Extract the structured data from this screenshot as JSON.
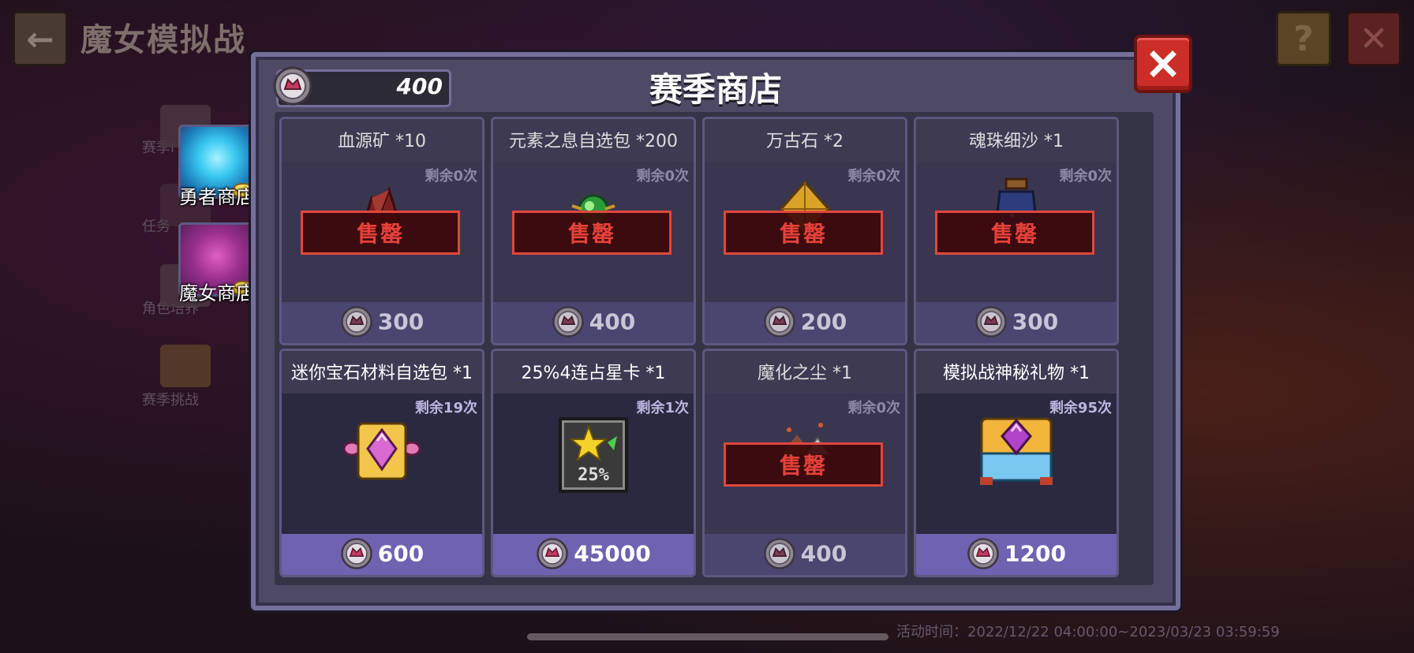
{
  "header": {
    "back_icon": "arrow-left-icon",
    "title": "魔女模拟战",
    "help_label": "?",
    "close_label": "✕"
  },
  "side_menu": {
    "items": [
      {
        "label": "赛季i"
      },
      {
        "label": "任务"
      },
      {
        "label": "角色培养"
      },
      {
        "label": "赛季挑战"
      }
    ]
  },
  "tabs": [
    {
      "label": "勇者商店"
    },
    {
      "label": "魔女商店"
    }
  ],
  "shop": {
    "title": "赛季商店",
    "currency_amount": "400",
    "currency_icon": "witch-coin-icon",
    "close_icon": "close-x-icon",
    "items": [
      {
        "name": "血源矿 *10",
        "remain": "剩余0次",
        "price": "300",
        "sold_out": true,
        "sold_label": "售罄"
      },
      {
        "name": "元素之息自选包 *200",
        "remain": "剩余0次",
        "price": "400",
        "sold_out": true,
        "sold_label": "售罄"
      },
      {
        "name": "万古石 *2",
        "remain": "剩余0次",
        "price": "200",
        "sold_out": true,
        "sold_label": "售罄"
      },
      {
        "name": "魂珠细沙 *1",
        "remain": "剩余0次",
        "price": "300",
        "sold_out": true,
        "sold_label": "售罄"
      },
      {
        "name": "迷你宝石材料自选包 *1",
        "remain": "剩余19次",
        "price": "600",
        "sold_out": false
      },
      {
        "name": "25%4连占星卡 *1",
        "remain": "剩余1次",
        "price": "45000",
        "sold_out": false,
        "card_text": "25%"
      },
      {
        "name": "魔化之尘 *1",
        "remain": "剩余0次",
        "price": "400",
        "sold_out": true,
        "sold_label": "售罄"
      },
      {
        "name": "模拟战神秘礼物 *1",
        "remain": "剩余95次",
        "price": "1200",
        "sold_out": false
      }
    ]
  },
  "footer": {
    "event_time": "活动时间：2022/12/22 04:00:00~2023/03/23 03:59:59"
  },
  "colors": {
    "modal_bg": "#4e4965",
    "sold_out_red": "#e7413a",
    "active_footer": "#6f62b0",
    "close_red": "#cb2e28"
  }
}
